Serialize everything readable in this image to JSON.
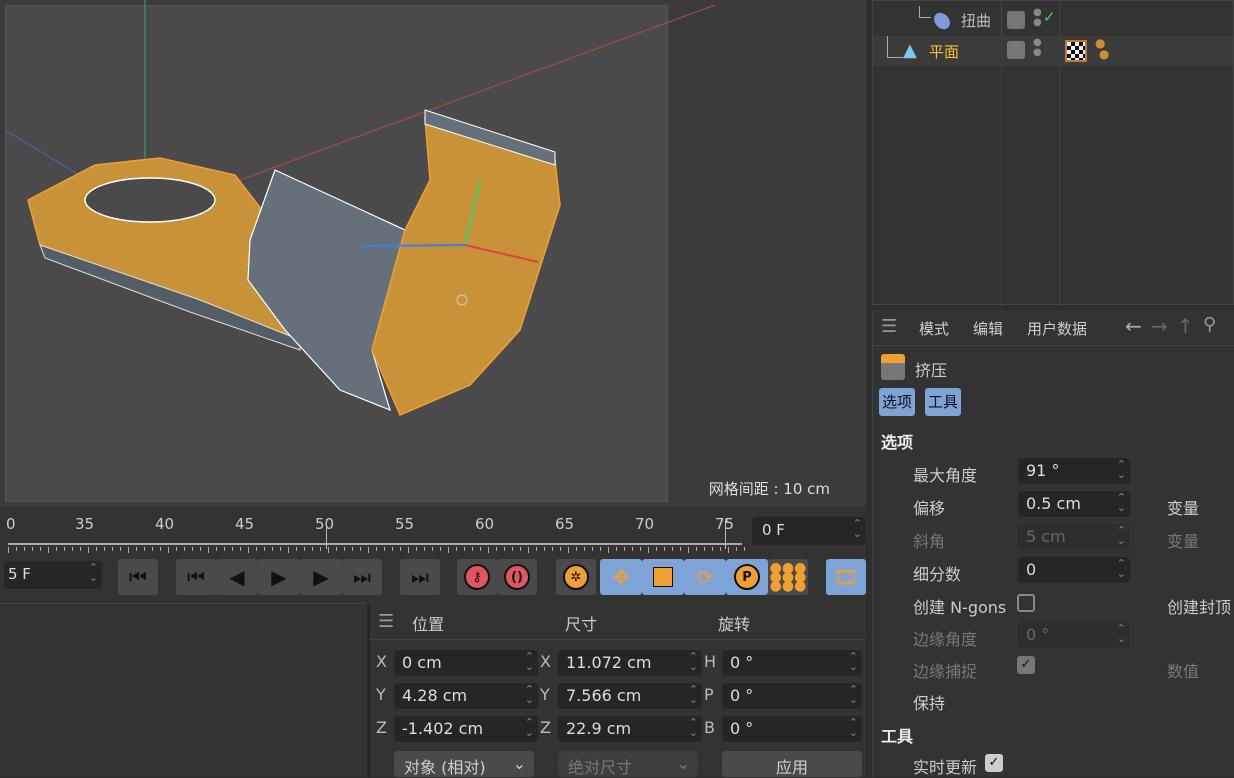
{
  "viewport": {
    "grid_spacing_label": "网格间距 : 10 cm"
  },
  "timeline": {
    "tick_labels": [
      "0",
      "35",
      "40",
      "45",
      "50",
      "55",
      "60",
      "65",
      "70",
      "75"
    ],
    "end_frame": "0 F",
    "current_frame": "5 F"
  },
  "transport": {
    "buttons": [
      "go-to-start",
      "previous-key",
      "previous-frame",
      "play",
      "next-frame",
      "next-key",
      "go-to-end",
      "record",
      "autokey",
      "keyframe-settings",
      "move",
      "scale",
      "rotate",
      "parameter",
      "point-level-animation",
      "timeline-window"
    ]
  },
  "coordinates": {
    "headers": {
      "position": "位置",
      "size": "尺寸",
      "rotation": "旋转"
    },
    "position": [
      {
        "axis": "X",
        "value": "0 cm"
      },
      {
        "axis": "Y",
        "value": "4.28 cm"
      },
      {
        "axis": "Z",
        "value": "-1.402 cm"
      }
    ],
    "size": [
      {
        "axis": "X",
        "value": "11.072 cm"
      },
      {
        "axis": "Y",
        "value": "7.566 cm"
      },
      {
        "axis": "Z",
        "value": "22.9 cm"
      }
    ],
    "rotation": [
      {
        "axis": "H",
        "value": "0 °"
      },
      {
        "axis": "P",
        "value": "0 °"
      },
      {
        "axis": "B",
        "value": "0 °"
      }
    ],
    "mode_dropdown": "对象 (相对)",
    "size_dropdown": "绝对尺寸",
    "apply_button": "应用"
  },
  "object_manager": {
    "objects": [
      {
        "name": "扭曲",
        "icon": "bend-deformer-icon",
        "enabled": true
      },
      {
        "name": "平面",
        "icon": "plane-icon",
        "selected": true,
        "name_color": "#f2c232"
      }
    ]
  },
  "attributes": {
    "menu": [
      "模式",
      "编辑",
      "用户数据"
    ],
    "object_name": "挤压",
    "tabs": [
      "选项",
      "工具"
    ],
    "section_options": "选项",
    "fields": {
      "max_angle": {
        "label": "最大角度",
        "value": "91 °"
      },
      "offset": {
        "label": "偏移",
        "value": "0.5 cm"
      },
      "offset_var": {
        "label": "变量"
      },
      "bevel": {
        "label": "斜角",
        "value": "5 cm"
      },
      "bevel_var": {
        "label": "变量"
      },
      "subdivision": {
        "label": "细分数",
        "value": "0"
      },
      "create_ngons": {
        "label": "创建 N-gons",
        "checked": false
      },
      "create_caps": {
        "label": "创建封顶"
      },
      "edge_angle": {
        "label": "边缘角度",
        "value": "0 °"
      },
      "edge_snap": {
        "label": "边缘捕捉",
        "checked": true
      },
      "value": {
        "label": "数值"
      },
      "keep": {
        "label": "保持"
      }
    },
    "section_tool": "工具",
    "realtime_update": {
      "label": "实时更新",
      "checked": true
    }
  },
  "colors": {
    "accent_blue": "#7ea3d6",
    "selection_orange": "#f0a030",
    "record_red": "#e05560"
  }
}
